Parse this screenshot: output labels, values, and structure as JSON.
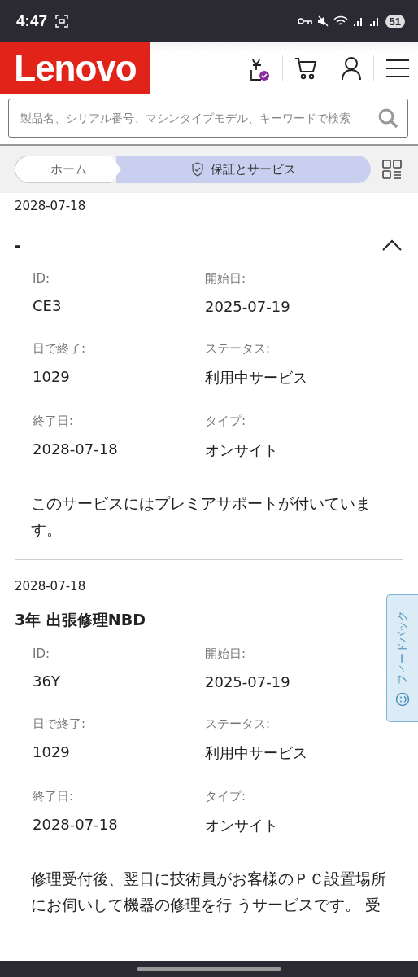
{
  "status_bar": {
    "time": "4:47",
    "battery": "51"
  },
  "header": {
    "logo": "Lenovo"
  },
  "search": {
    "placeholder": "製品名、シリアル番号、マシンタイプモデル、キーワードで検索"
  },
  "breadcrumb": [
    {
      "label": "ホーム",
      "selected": false
    },
    {
      "label": "保証とサービス",
      "selected": true
    }
  ],
  "top_date": "2028-07-18",
  "services": [
    {
      "title": "-",
      "expanded": true,
      "fields": [
        {
          "label": "ID:",
          "value": "CE3"
        },
        {
          "label": "開始日:",
          "value": "2025-07-19"
        },
        {
          "label": "日で終了:",
          "value": "1029"
        },
        {
          "label": "ステータス:",
          "value": "利用中サービス"
        },
        {
          "label": "終了日:",
          "value": "2028-07-18"
        },
        {
          "label": "タイプ:",
          "value": "オンサイト"
        }
      ],
      "description": "このサービスにはプレミアサポートが付いています。"
    },
    {
      "date": "2028-07-18",
      "title": "3年 出張修理NBD",
      "fields": [
        {
          "label": "ID:",
          "value": "36Y"
        },
        {
          "label": "開始日:",
          "value": "2025-07-19"
        },
        {
          "label": "日で終了:",
          "value": "1029"
        },
        {
          "label": "ステータス:",
          "value": "利用中サービス"
        },
        {
          "label": "終了日:",
          "value": "2028-07-18"
        },
        {
          "label": "タイプ:",
          "value": "オンサイト"
        }
      ],
      "description": "修理受付後、翌日に技術員がお客様のＰＣ設置場所にお伺いして機器の修理を行 うサービスです。 受"
    }
  ],
  "feedback": {
    "label": "フィードバック"
  }
}
